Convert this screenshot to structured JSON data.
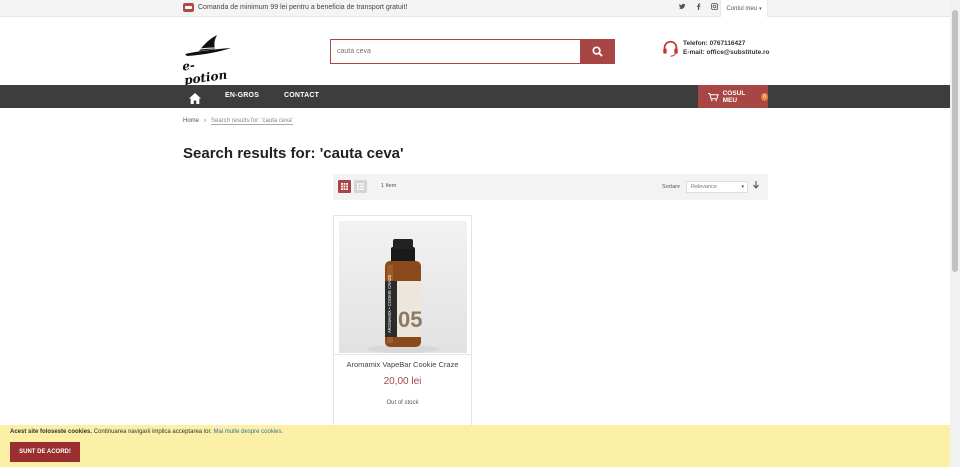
{
  "topbar": {
    "promo_text": "Comanda de minimum 99 lei pentru a beneficia de transport gratuit!",
    "social_icons": [
      "twitter-icon",
      "facebook-icon",
      "instagram-icon"
    ],
    "account_label": "Contul meu"
  },
  "header": {
    "logo_text": "e-potion",
    "search_placeholder": "cauta ceva",
    "phone_line": "Telefon: 0767116427",
    "email_line": "E-mail: office@substitute.ro"
  },
  "nav": {
    "items": [
      "EN-GROS",
      "CONTACT"
    ],
    "cart_label": "COSUL MEU",
    "cart_count": "0"
  },
  "breadcrumb": {
    "home": "Home",
    "current": "Search results for: 'cauta ceva'"
  },
  "page_title": "Search results for: 'cauta ceva'",
  "toolbar": {
    "item_count": "1 Item",
    "sort_label": "Sortare",
    "sort_value": "Relevance"
  },
  "product": {
    "name": "Aromamix VapeBar Cookie Craze",
    "price": "20,00 lei",
    "stock": "Out of stock",
    "label_brand": "AROMAMIX • COOKIE CRAZE",
    "label_number": "05"
  },
  "cookie": {
    "bold_text": "Acest site foloseste cookies.",
    "text": "Continuarea navigarii implica acceptarea lor.",
    "link_text": "Mai multe despre cookies.",
    "button_label": "SUNT DE ACORD!"
  },
  "colors": {
    "accent": "#a84646",
    "nav_bg": "#3d3d3d",
    "cookie_bg": "#fbf0a6"
  }
}
